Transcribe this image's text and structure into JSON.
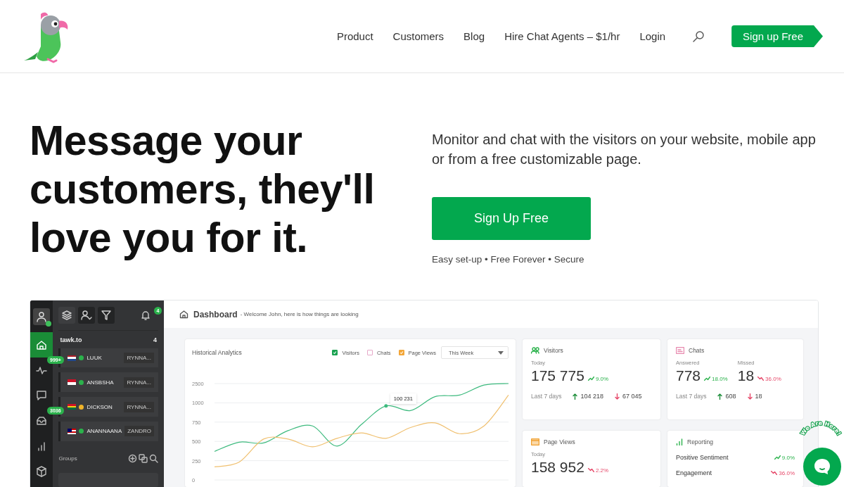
{
  "nav": {
    "links": [
      "Product",
      "Customers",
      "Blog",
      "Hire Chat Agents – $1/hr",
      "Login"
    ],
    "cta": "Sign up Free"
  },
  "hero": {
    "headline": "Message your customers, they'll love you for it.",
    "lead": "Monitor and chat with the visitors on your website, mobile app or from a free customizable page.",
    "cta": "Sign Up Free",
    "features": "Easy set-up • Free Forever • Secure"
  },
  "app": {
    "notifications": "4",
    "rail": [
      {
        "selected": true
      },
      {
        "selected": false,
        "badge": "999+"
      },
      {
        "selected": false
      },
      {
        "selected": false,
        "badge": "3036"
      },
      {
        "selected": false
      },
      {
        "selected": false
      }
    ],
    "property": "tawk.to",
    "visitor_count": "4",
    "visitors": [
      {
        "color": "#2bb24c",
        "name": "LUUK",
        "agent": "RYNNA..."
      },
      {
        "color": "#2bb24c",
        "name": "ANSBSHA",
        "agent": "RYNNA..."
      },
      {
        "color": "#f0b429",
        "name": "DICKSON",
        "agent": "RYNNA..."
      },
      {
        "color": "#2bb24c",
        "name": "ANANNAANA",
        "agent": "ZANDRO"
      }
    ],
    "groups": "Groups",
    "title": "Dashboard",
    "subtitle": "- Welcome John, here is how things are looking",
    "analytics": {
      "title": "Historical Analytics",
      "legend": [
        {
          "checked": true,
          "color": "#1aa251"
        },
        {
          "label": "Chats",
          "checked": false,
          "color": "#e6a8c8"
        },
        {
          "checked": true,
          "color": "#f3a638"
        }
      ],
      "period": "This Week",
      "tooltip": "100 231",
      "y_axis_top_label": "2500",
      "chart_data": {
        "type": "line",
        "grid": true,
        "ylim": [
          0,
          1250
        ],
        "yticks": [
          0,
          250,
          500,
          750,
          1000
        ],
        "series": [
          {
            "name": "Visitors",
            "color": "#3dba7e",
            "values": [
              370,
              490,
              480,
              640,
              700,
              440,
              720,
              960,
              900,
              1080,
              1100,
              1230,
              1250
            ]
          },
          {
            "name": "Page Views",
            "color": "#f0c070",
            "values": [
              170,
              230,
              530,
              530,
              430,
              540,
              610,
              540,
              680,
              740,
              600,
              700,
              1100
            ]
          }
        ]
      }
    },
    "visitors_card": {
      "title": "Visitors",
      "caption": "Today",
      "value": "175 775",
      "trend": "9.0%",
      "footer": "Last 7 days",
      "up": "104 218",
      "down": "67 045"
    },
    "chats_card": {
      "title": "Chats",
      "answered_label": "Answered",
      "answered": "778",
      "answered_trend": "18.0%",
      "missed_label": "Missed",
      "missed": "18",
      "missed_trend": "36.0%",
      "footer": "Last 7 days",
      "up": "608",
      "down": "18"
    },
    "pageviews_card": {
      "title": "Page Views",
      "caption": "Today",
      "value": "158 952",
      "trend": "2.2%"
    },
    "reporting_card": {
      "title": "Reporting",
      "rows": [
        {
          "label": "Positive Sentiment",
          "value": "9.0%",
          "up": true
        },
        {
          "label": "Engagement",
          "value": "36.0%",
          "up": false
        }
      ]
    }
  },
  "widget": {
    "text": "We Are Here!"
  }
}
